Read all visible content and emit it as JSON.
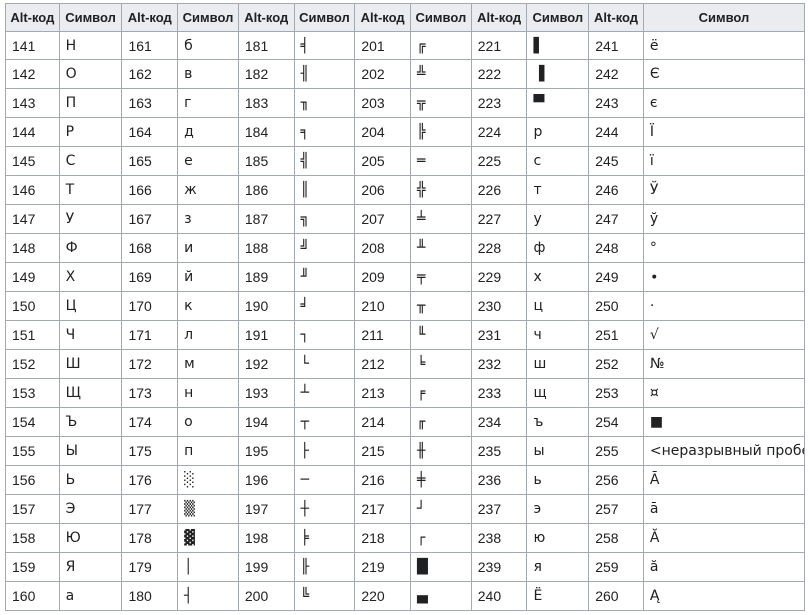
{
  "table": {
    "headers": [
      "Alt-код",
      "Символ",
      "Alt-код",
      "Символ",
      "Alt-код",
      "Символ",
      "Alt-код",
      "Символ",
      "Alt-код",
      "Символ",
      "Alt-код",
      "Символ"
    ],
    "rows": [
      [
        "141",
        "Н",
        "161",
        "б",
        "181",
        "╡",
        "201",
        "╔",
        "221",
        "▌",
        "241",
        "ё"
      ],
      [
        "142",
        "О",
        "162",
        "в",
        "182",
        "╢",
        "202",
        "╩",
        "222",
        "▐",
        "242",
        "Є"
      ],
      [
        "143",
        "П",
        "163",
        "г",
        "183",
        "╖",
        "203",
        "╦",
        "223",
        "▀",
        "243",
        "є"
      ],
      [
        "144",
        "Р",
        "164",
        "д",
        "184",
        "╕",
        "204",
        "╠",
        "224",
        "р",
        "244",
        "Ї"
      ],
      [
        "145",
        "С",
        "165",
        "е",
        "185",
        "╣",
        "205",
        "═",
        "225",
        "с",
        "245",
        "ї"
      ],
      [
        "146",
        "Т",
        "166",
        "ж",
        "186",
        "║",
        "206",
        "╬",
        "226",
        "т",
        "246",
        "Ў"
      ],
      [
        "147",
        "У",
        "167",
        "з",
        "187",
        "╗",
        "207",
        "╧",
        "227",
        "у",
        "247",
        "ў"
      ],
      [
        "148",
        "Ф",
        "168",
        "и",
        "188",
        "╝",
        "208",
        "╨",
        "228",
        "ф",
        "248",
        "°"
      ],
      [
        "149",
        "Х",
        "169",
        "й",
        "189",
        "╜",
        "209",
        "╤",
        "229",
        "х",
        "249",
        "∙"
      ],
      [
        "150",
        "Ц",
        "170",
        "к",
        "190",
        "╛",
        "210",
        "╥",
        "230",
        "ц",
        "250",
        "·"
      ],
      [
        "151",
        "Ч",
        "171",
        "л",
        "191",
        "┐",
        "211",
        "╙",
        "231",
        "ч",
        "251",
        "√"
      ],
      [
        "152",
        "Ш",
        "172",
        "м",
        "192",
        "└",
        "212",
        "╘",
        "232",
        "ш",
        "252",
        "№"
      ],
      [
        "153",
        "Щ",
        "173",
        "н",
        "193",
        "┴",
        "213",
        "╒",
        "233",
        "щ",
        "253",
        "¤"
      ],
      [
        "154",
        "Ъ",
        "174",
        "о",
        "194",
        "┬",
        "214",
        "╓",
        "234",
        "ъ",
        "254",
        "■"
      ],
      [
        "155",
        "Ы",
        "175",
        "п",
        "195",
        "├",
        "215",
        "╫",
        "235",
        "ы",
        "255",
        "<неразрывный пробел>"
      ],
      [
        "156",
        "Ь",
        "176",
        "░",
        "196",
        "─",
        "216",
        "╪",
        "236",
        "ь",
        "256",
        "Ā"
      ],
      [
        "157",
        "Э",
        "177",
        "▒",
        "197",
        "┼",
        "217",
        "┘",
        "237",
        "э",
        "257",
        "ā"
      ],
      [
        "158",
        "Ю",
        "178",
        "▓",
        "198",
        "╞",
        "218",
        "┌",
        "238",
        "ю",
        "258",
        "Ă"
      ],
      [
        "159",
        "Я",
        "179",
        "│",
        "199",
        "╟",
        "219",
        "█",
        "239",
        "я",
        "259",
        "ă"
      ],
      [
        "160",
        "а",
        "180",
        "┤",
        "200",
        "╚",
        "220",
        "▄",
        "240",
        "Ё",
        "260",
        "Ą"
      ]
    ]
  }
}
